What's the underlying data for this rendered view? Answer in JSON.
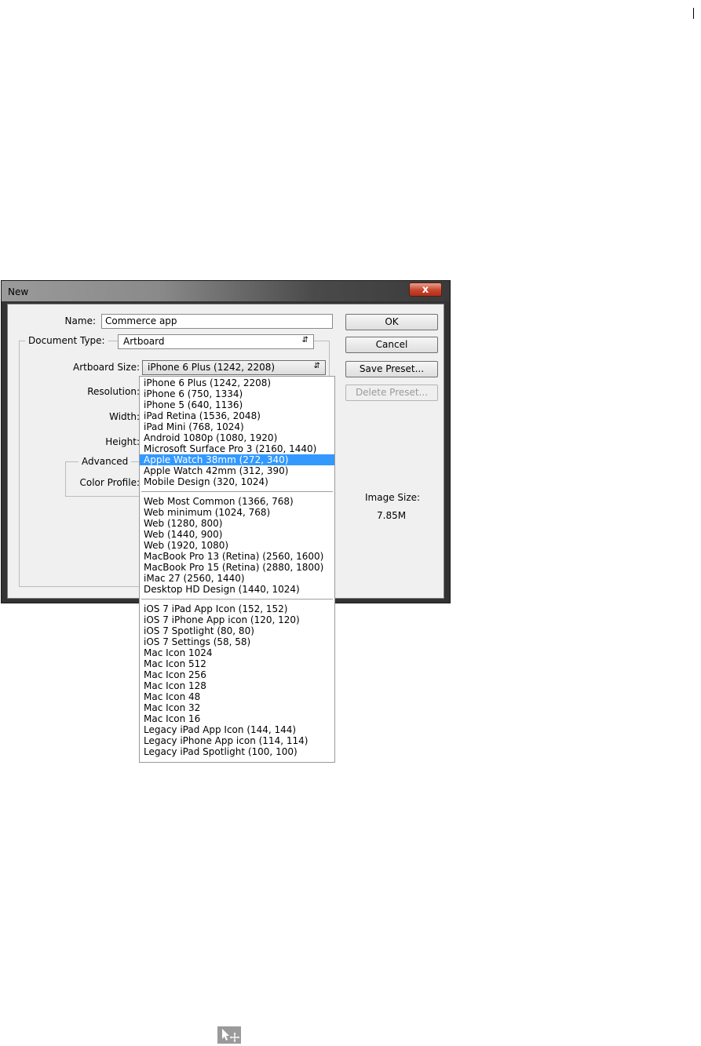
{
  "dialog": {
    "title": "New",
    "close_label": "x",
    "name_label": "Name:",
    "name_value": "Commerce app",
    "document_type_label": "Document Type:",
    "document_type_value": "Artboard",
    "artboard_size_label": "Artboard Size:",
    "artboard_size_value": "iPhone 6 Plus (1242, 2208)",
    "resolution_label": "Resolution:",
    "width_label": "Width:",
    "height_label": "Height:",
    "advanced_label": "Advanced",
    "color_profile_label": "Color Profile:",
    "image_size_label": "Image Size:",
    "image_size_value": "7.85M",
    "buttons": {
      "ok": "OK",
      "cancel": "Cancel",
      "save_preset": "Save Preset...",
      "delete_preset": "Delete Preset..."
    }
  },
  "dropdown": {
    "groups": [
      [
        "iPhone 6 Plus (1242, 2208)",
        "iPhone 6 (750, 1334)",
        "iPhone 5 (640, 1136)",
        "iPad Retina (1536, 2048)",
        "iPad Mini (768, 1024)",
        "Android 1080p (1080, 1920)",
        "Microsoft Surface Pro 3 (2160, 1440)",
        "Apple Watch 38mm (272, 340)",
        "Apple Watch 42mm (312, 390)",
        "Mobile Design (320, 1024)"
      ],
      [
        "Web Most Common (1366, 768)",
        "Web minimum (1024, 768)",
        "Web (1280, 800)",
        "Web (1440, 900)",
        "Web (1920, 1080)",
        "MacBook Pro 13 (Retina) (2560, 1600)",
        "MacBook Pro 15 (Retina) (2880, 1800)",
        "iMac 27 (2560, 1440)",
        "Desktop HD Design (1440, 1024)"
      ],
      [
        "iOS 7 iPad App Icon (152, 152)",
        "iOS 7 iPhone App icon (120, 120)",
        "iOS 7 Spotlight (80, 80)",
        "iOS 7 Settings (58, 58)",
        "Mac Icon 1024",
        "Mac Icon 512",
        "Mac Icon 256",
        "Mac Icon 128",
        "Mac Icon 48",
        "Mac Icon 32",
        "Mac Icon 16",
        "Legacy iPad App Icon (144, 144)",
        "Legacy iPhone App icon (114, 114)",
        "Legacy iPad Spotlight (100, 100)"
      ]
    ],
    "highlighted": "Apple Watch 38mm (272, 340)"
  },
  "icons": {
    "cursor": "artboard-move-cursor-icon"
  }
}
